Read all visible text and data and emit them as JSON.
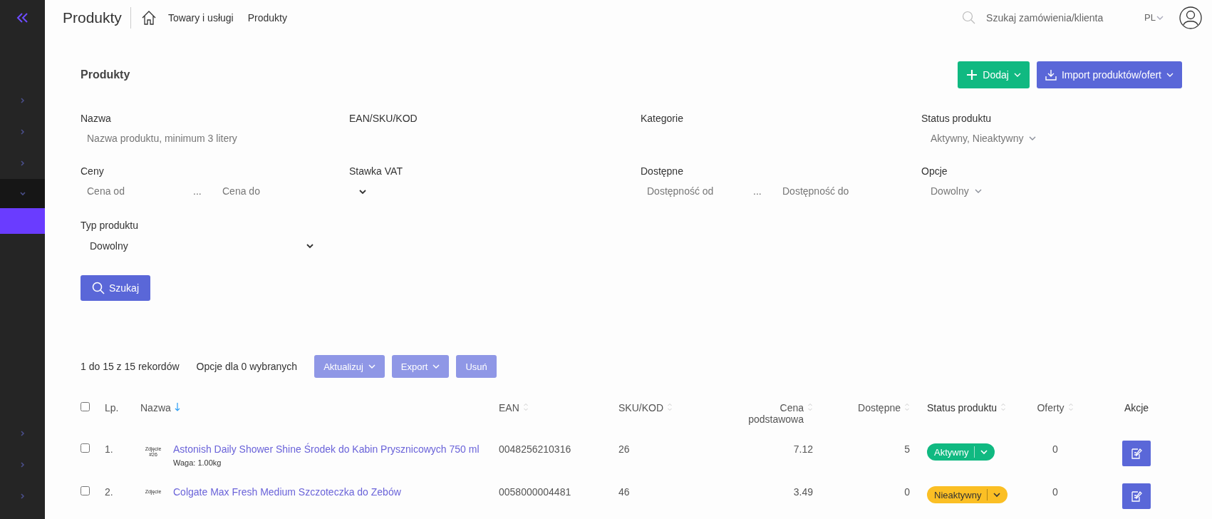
{
  "sidebar": {
    "items": [
      {
        "expanded": false,
        "selected": false
      },
      {
        "expanded": false,
        "selected": false
      },
      {
        "expanded": false,
        "selected": false
      },
      {
        "expanded": true,
        "selected": false
      },
      {
        "expanded": false,
        "selected": true
      },
      {
        "expanded": false,
        "selected": false
      },
      {
        "expanded": false,
        "selected": false
      },
      {
        "expanded": false,
        "selected": false
      }
    ]
  },
  "header": {
    "title": "Produkty",
    "breadcrumbs": [
      "Towary i usługi",
      "Produkty"
    ],
    "search": {
      "placeholder": "Szukaj zamówienia/klienta"
    },
    "language": "PL"
  },
  "panel": {
    "title": "Produkty",
    "add_button": "Dodaj",
    "import_button": "Import produktów/ofert"
  },
  "filters": [
    {
      "kind": "text",
      "label": "Nazwa",
      "placeholder": "Nazwa produktu, minimum 3 litery"
    },
    {
      "kind": "text",
      "label": "EAN/SKU/KOD"
    },
    {
      "kind": "text",
      "label": "Kategorie"
    },
    {
      "kind": "dropdown",
      "label": "Status produktu",
      "value": "Aktywny, Nieaktywny"
    },
    {
      "kind": "range",
      "label": "Ceny",
      "from_placeholder": "Cena od",
      "separator": "...",
      "to_placeholder": "Cena do"
    },
    {
      "kind": "select",
      "label": "Stawka VAT"
    },
    {
      "kind": "range",
      "label": "Dostępne",
      "from_placeholder": "Dostępność od",
      "separator": "...",
      "to_placeholder": "Dostępność do"
    },
    {
      "kind": "dropdown",
      "label": "Opcje",
      "value": "Dowolny"
    },
    {
      "kind": "select",
      "label": "Typ produktu",
      "value": "Dowolny"
    }
  ],
  "search_button": "Szukaj",
  "toolbar": {
    "records": "1 do 15 z 15 rekordów",
    "selection": "Opcje dla 0 wybranych",
    "buttons": [
      {
        "label": "Aktualizuj",
        "dropdown": true
      },
      {
        "label": "Export",
        "dropdown": true
      },
      {
        "label": "Usuń",
        "dropdown": false
      }
    ]
  },
  "table": {
    "select_all": {
      "checked": false
    },
    "columns": [
      {
        "label": "Lp.",
        "sortable": false,
        "sorted": false
      },
      {
        "label": "Nazwa",
        "sortable": true,
        "sorted": true
      },
      {
        "label": "EAN",
        "sortable": true,
        "sorted": false
      },
      {
        "label": "SKU/KOD",
        "sortable": true,
        "sorted": false
      },
      {
        "label": "Cena podstawowa",
        "sortable": true,
        "sorted": false
      },
      {
        "label": "Dostępne",
        "sortable": true,
        "sorted": false
      },
      {
        "label": "Status produktu",
        "sortable": true,
        "sorted": false
      },
      {
        "label": "Oferty",
        "sortable": true,
        "sorted": false
      },
      {
        "label": "Akcje",
        "sortable": false,
        "sorted": false
      }
    ],
    "rows": [
      {
        "checked": false,
        "lp": "1.",
        "thumb": "Zdjęcie #26",
        "name": "Astonish Daily Shower Shine Środek do Kabin Prysznicowych 750 ml",
        "weight": "Waga: 1.00kg",
        "ean": "0048256210316",
        "sku": "26",
        "price": "7.12",
        "available": "5",
        "status": "Aktywny",
        "active": true,
        "offers": "0"
      },
      {
        "checked": false,
        "lp": "2.",
        "thumb": "Zdjęcie",
        "name": "Colgate Max Fresh Medium Szczoteczka do Zebów",
        "ean": "0058000004481",
        "sku": "46",
        "price": "3.49",
        "available": "0",
        "status": "Nieaktywny",
        "active": false,
        "offers": "0"
      }
    ]
  }
}
